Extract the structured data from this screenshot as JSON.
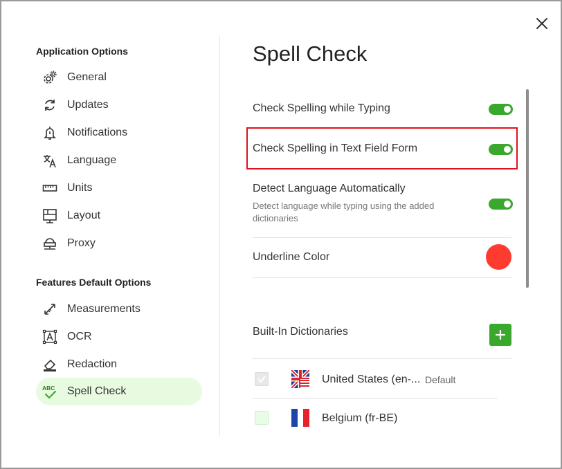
{
  "dialog": {
    "close_icon": "close-icon",
    "sidebar": {
      "sections": [
        {
          "title": "Application Options",
          "items": [
            {
              "label": "General",
              "icon": "gear-icon"
            },
            {
              "label": "Updates",
              "icon": "sync-icon"
            },
            {
              "label": "Notifications",
              "icon": "bell-icon"
            },
            {
              "label": "Language",
              "icon": "translate-icon"
            },
            {
              "label": "Units",
              "icon": "ruler-icon"
            },
            {
              "label": "Layout",
              "icon": "layout-icon"
            },
            {
              "label": "Proxy",
              "icon": "network-icon"
            }
          ]
        },
        {
          "title": "Features Default Options",
          "items": [
            {
              "label": "Measurements",
              "icon": "measure-icon"
            },
            {
              "label": "OCR",
              "icon": "ocr-icon"
            },
            {
              "label": "Redaction",
              "icon": "eraser-icon"
            },
            {
              "label": "Spell Check",
              "icon": "spellcheck-icon",
              "active": true
            }
          ]
        }
      ]
    },
    "main": {
      "title": "Spell Check",
      "settings": [
        {
          "label": "Check Spelling while Typing",
          "enabled": true
        },
        {
          "label": "Check Spelling in Text Field Form",
          "enabled": true,
          "highlighted": true
        },
        {
          "label": "Detect Language Automatically",
          "description": "Detect language while typing using the added dictionaries",
          "enabled": true
        }
      ],
      "underline_color": {
        "label": "Underline Color",
        "color": "#ff3b30"
      },
      "dictionaries": {
        "title": "Built-In Dictionaries",
        "add_icon": "plus-icon",
        "items": [
          {
            "name": "United States (en-...",
            "badge": "Default",
            "checked": true,
            "disabled": true,
            "flag": "us-uk-flag-icon"
          },
          {
            "name": "Belgium (fr-BE)",
            "checked": false,
            "flag": "france-flag-icon"
          }
        ]
      }
    },
    "colors": {
      "accent": "#3aa82c",
      "active_bg": "#e8fbe1",
      "highlight_border": "#e0111a"
    }
  }
}
